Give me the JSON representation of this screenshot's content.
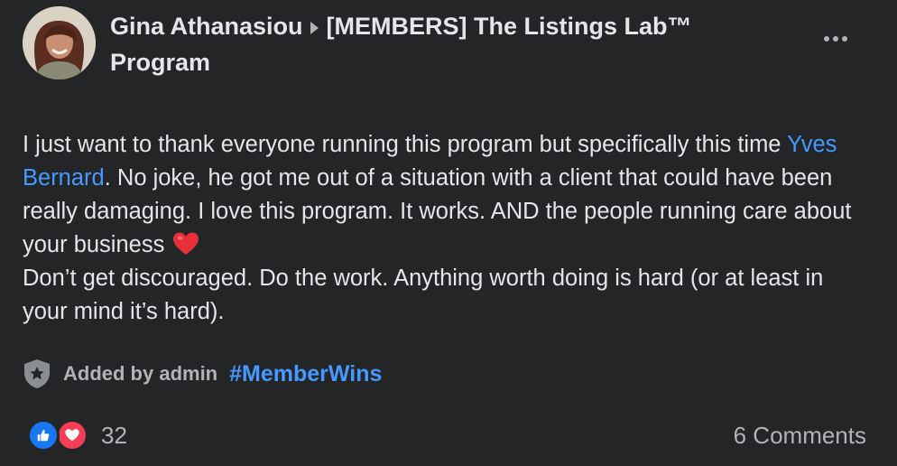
{
  "post": {
    "author": "Gina Athanasiou",
    "group": "[MEMBERS] The Listings Lab™ Program",
    "body": {
      "line1": "I just want to thank everyone running this program but specifically this time ",
      "mention": "Yves Bernard",
      "line1_rest": ".  No joke, he got me out of a situation with a client that could have been really damaging.  I love this program.  It works.  AND the people running care about your business ",
      "line2": "Don’t get discouraged.  Do the work.  Anything worth doing is hard (or at least in your mind it’s hard)."
    },
    "admin_note": "Added by admin",
    "hashtag": "#MemberWins",
    "reaction_count": "32",
    "comments": "6 Comments"
  },
  "icons": {
    "avatar": "avatar",
    "caret": "caret-right-icon",
    "more": "more-options-icon",
    "heart": "heart-emoji",
    "admin": "shield-icon",
    "like": "like-reaction-icon",
    "love": "love-reaction-icon"
  },
  "colors": {
    "background": "#242526",
    "text": "#e4e6eb",
    "secondary_text": "#b0b3b8",
    "link": "#4599ff",
    "like": "#1877f2",
    "love": "#f33e58"
  }
}
